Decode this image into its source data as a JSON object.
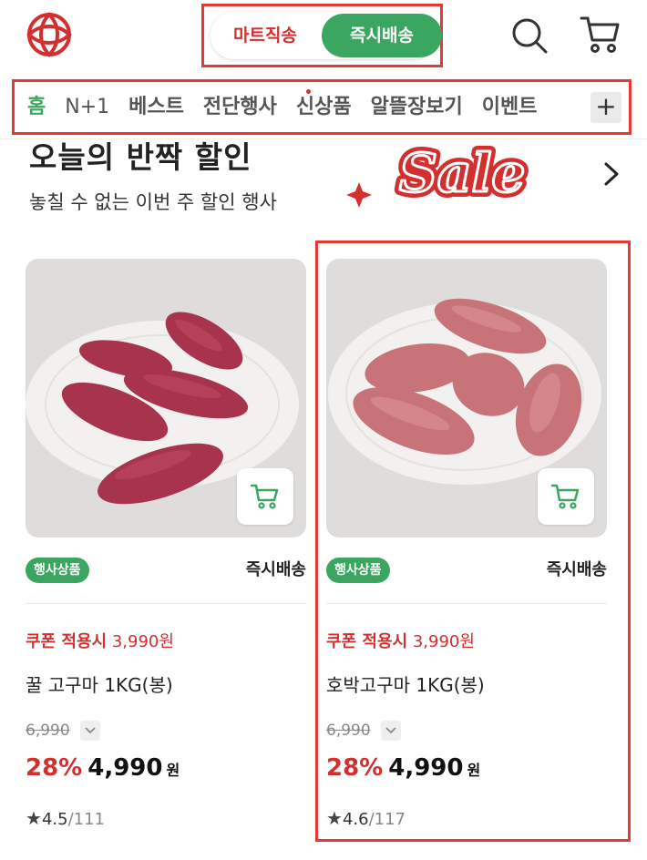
{
  "header": {
    "toggle_left": "마트직송",
    "toggle_right": "즉시배송",
    "brand_color": "#d32f2f",
    "accent_color": "#3aa660"
  },
  "nav": {
    "items": [
      "홈",
      "N+1",
      "베스트",
      "전단행사",
      "신상품",
      "알뜰장보기",
      "이벤트"
    ],
    "active_index": 0,
    "more_label": "+"
  },
  "banner": {
    "title": "오늘의 반짝 할인",
    "subtitle": "놓칠 수 없는 이번 주 할인 행사",
    "art_text": "Sale"
  },
  "products": [
    {
      "badge": "행사상품",
      "delivery": "즉시배송",
      "coupon_label": "쿠폰 적용시",
      "coupon_price": "3,990원",
      "name_main": "꿀 고구마",
      "name_unit": "1KG(봉)",
      "original_price": "6,990",
      "discount": "28%",
      "price": "4,990",
      "currency": "원",
      "rating": "4.5",
      "reviews": "/111"
    },
    {
      "badge": "행사상품",
      "delivery": "즉시배송",
      "coupon_label": "쿠폰 적용시",
      "coupon_price": "3,990원",
      "name_main": "호박고구마",
      "name_unit": "1KG(봉)",
      "original_price": "6,990",
      "discount": "28%",
      "price": "4,990",
      "currency": "원",
      "rating": "4.6",
      "reviews": "/117"
    }
  ]
}
